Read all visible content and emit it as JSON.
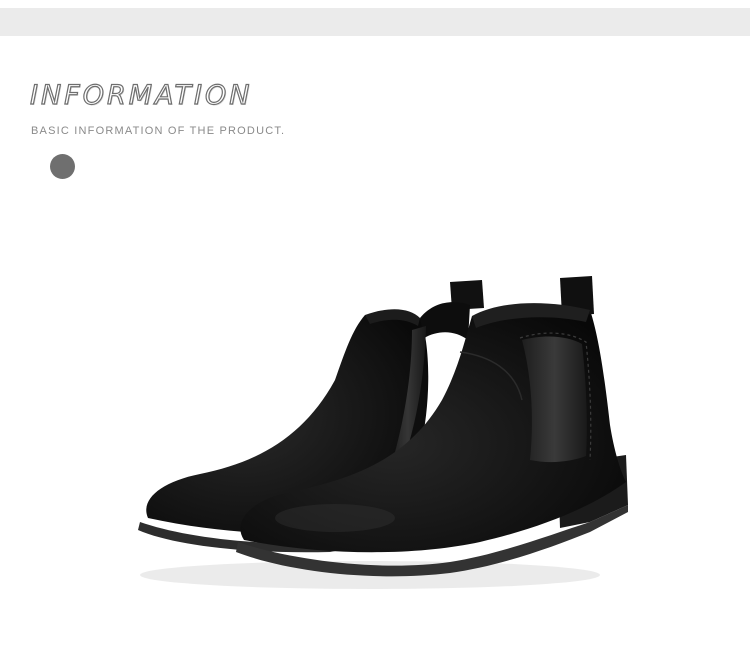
{
  "header": {
    "title": "INFORMATION",
    "subtitle": "BASIC INFORMATION OF THE PRODUCT."
  },
  "colors": {
    "band": "#ebebeb",
    "title_outline": "#6e6e6e",
    "subtitle": "#8a8a8a",
    "dot": "#6f6f6f",
    "suede": "#141414",
    "sole": "#2a2a2a"
  },
  "product": {
    "image": "black-suede-chelsea-boots-pair"
  }
}
